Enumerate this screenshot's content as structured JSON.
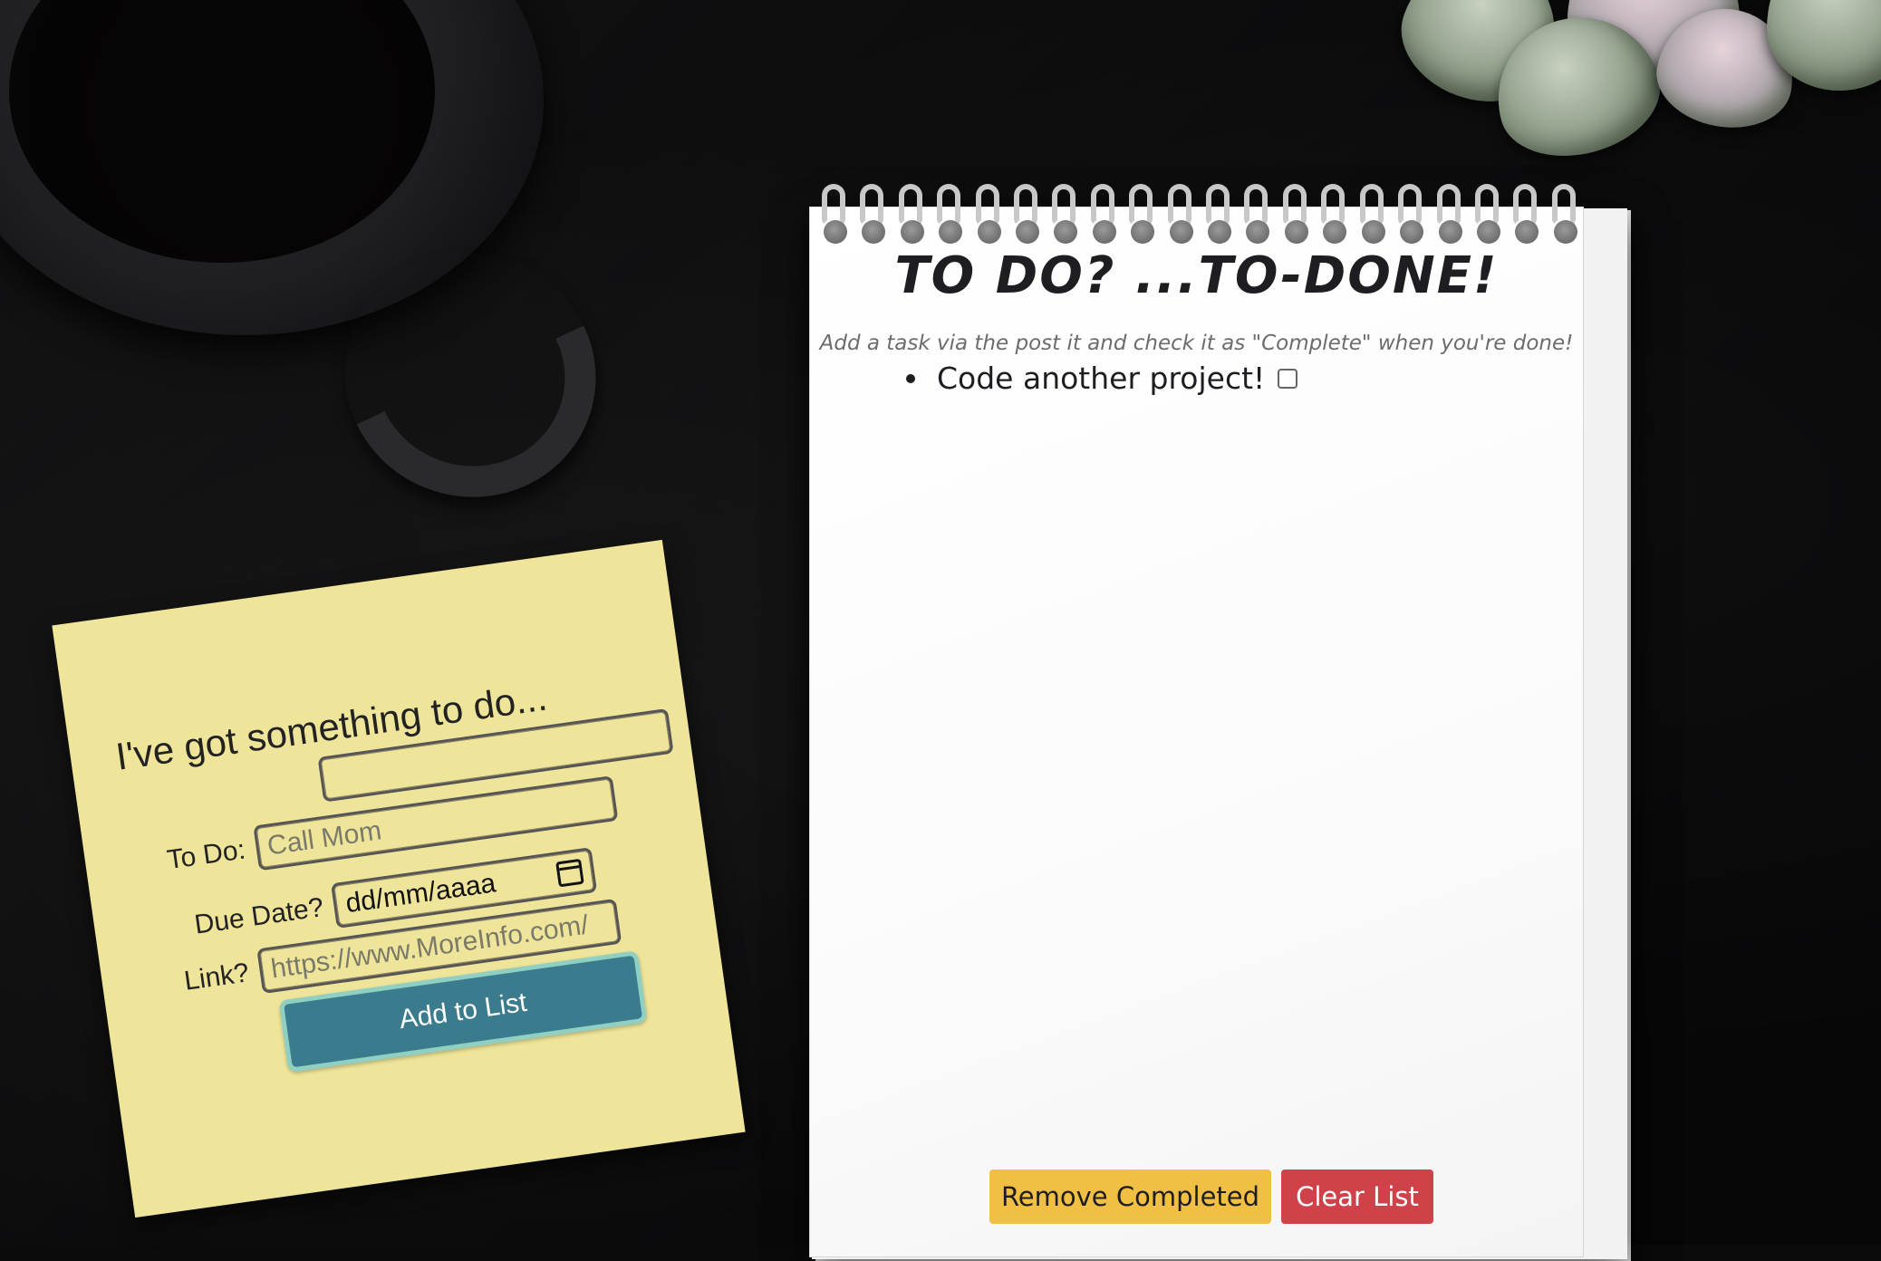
{
  "notepad": {
    "title": "To do? ...To-DONE!",
    "subtitle": "Add a task via the post it and check it as \"Complete\" when you're done!",
    "tasks": [
      {
        "text": "Code another project!",
        "completed": false
      }
    ],
    "remove_label": "Remove Completed",
    "clear_label": "Clear List",
    "remove_color": "#f0bf43",
    "clear_color": "#d0424a"
  },
  "sticky": {
    "heading": "I've got something to do...",
    "todo_label": "To Do:",
    "todo_placeholder": "Call Mom",
    "due_label": "Due Date?",
    "due_value": "dd/mm/aaaa",
    "link_label": "Link?",
    "link_placeholder": "https://www.MoreInfo.com/",
    "add_label": "Add to List",
    "note_color": "#efe59a",
    "button_color": "#3b7b8e"
  },
  "icons": {
    "calendar": "calendar-icon"
  }
}
